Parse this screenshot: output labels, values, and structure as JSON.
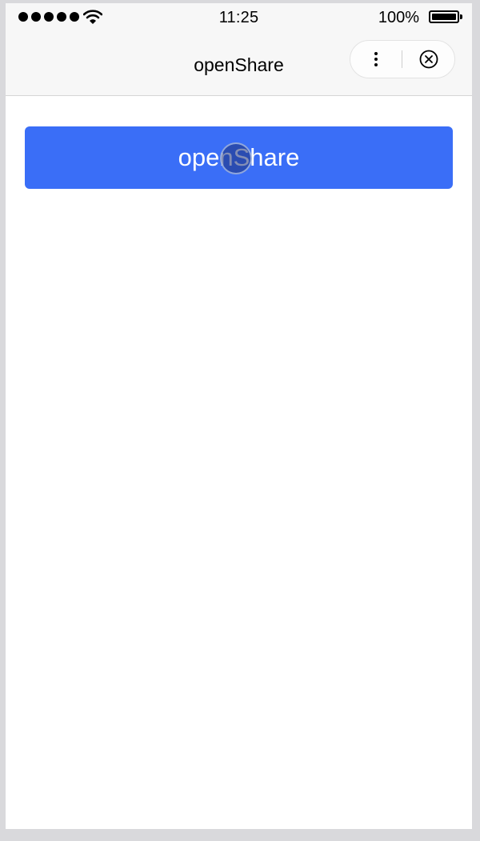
{
  "status_bar": {
    "time": "11:25",
    "battery_percent": "100%",
    "signal_icon": "signal-dots-icon",
    "wifi_icon": "wifi-icon",
    "battery_icon": "battery-icon"
  },
  "nav": {
    "title": "openShare",
    "more_icon": "more-dots-icon",
    "close_icon": "close-circle-icon"
  },
  "main": {
    "share_button_label": "openShare"
  },
  "colors": {
    "accent": "#3a6ef7",
    "nav_background": "#f7f7f7",
    "page_background": "#ffffff"
  }
}
